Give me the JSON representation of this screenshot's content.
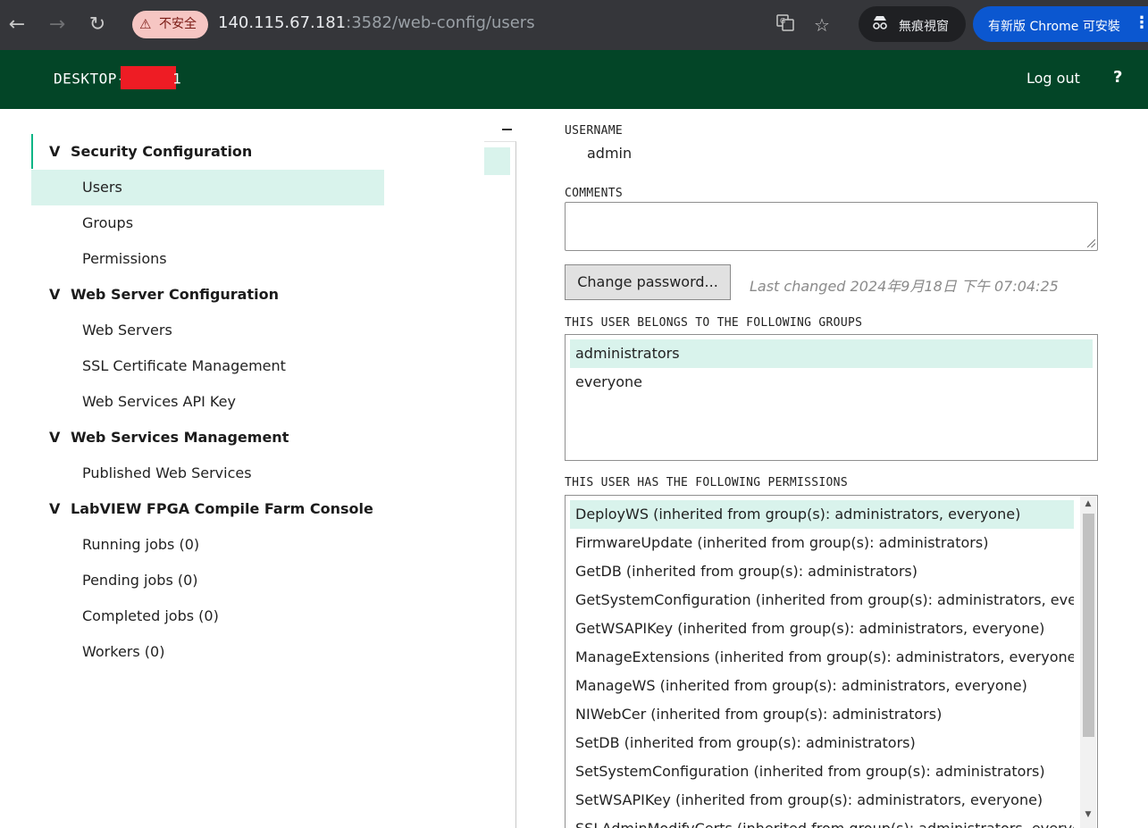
{
  "browser": {
    "security_label": "不安全",
    "url_host": "140.115.67.181",
    "url_rest": ":3582/web-config/users",
    "incognito_label": "無痕視窗",
    "update_label": "有新版 Chrome 可安裝"
  },
  "header": {
    "hostname_prefix": "DESKTOP-",
    "hostname_suffix": "1",
    "logout_label": "Log out",
    "help_label": "?"
  },
  "sidebar": {
    "sections": [
      {
        "label": "Security Configuration",
        "items": [
          "Users",
          "Groups",
          "Permissions"
        ]
      },
      {
        "label": "Web Server Configuration",
        "items": [
          "Web Servers",
          "SSL Certificate Management",
          "Web Services API Key"
        ]
      },
      {
        "label": "Web Services Management",
        "items": [
          "Published Web Services"
        ]
      },
      {
        "label": "LabVIEW FPGA Compile Farm Console",
        "items": [
          "Running jobs (0)",
          "Pending jobs (0)",
          "Completed jobs (0)",
          "Workers (0)"
        ]
      }
    ],
    "selected_item": "Users"
  },
  "user": {
    "username_label": "USERNAME",
    "username": "admin",
    "comments_label": "COMMENTS",
    "comments_value": "",
    "change_password_label": "Change password...",
    "last_changed": "Last changed 2024年9月18日 下午 07:04:25",
    "groups_label": "THIS USER BELONGS TO THE FOLLOWING GROUPS",
    "groups": [
      "administrators",
      "everyone"
    ],
    "permissions_label": "THIS USER HAS THE FOLLOWING PERMISSIONS",
    "permissions": [
      "DeployWS (inherited from group(s): administrators, everyone)",
      "FirmwareUpdate (inherited from group(s): administrators)",
      "GetDB (inherited from group(s): administrators)",
      "GetSystemConfiguration (inherited from group(s): administrators, everyone)",
      "GetWSAPIKey (inherited from group(s): administrators, everyone)",
      "ManageExtensions (inherited from group(s): administrators, everyone)",
      "ManageWS (inherited from group(s): administrators, everyone)",
      "NIWebCer (inherited from group(s): administrators)",
      "SetDB (inherited from group(s): administrators)",
      "SetSystemConfiguration (inherited from group(s): administrators)",
      "SetWSAPIKey (inherited from group(s): administrators, everyone)",
      "SSLAdminModifyCerts (inherited from group(s): administrators, everyone)"
    ]
  }
}
